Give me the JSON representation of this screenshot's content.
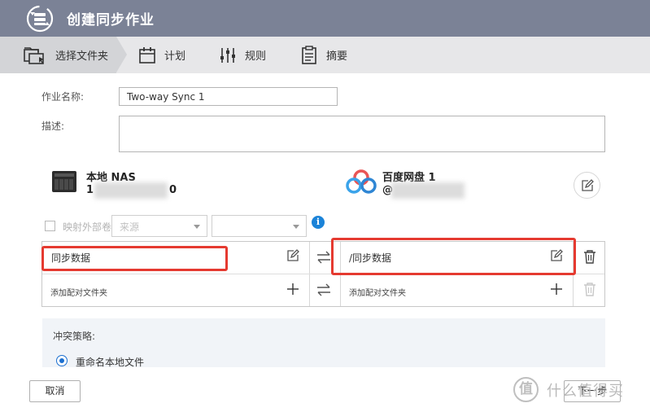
{
  "window": {
    "title": "创建同步作业"
  },
  "steps": [
    {
      "label": "选择文件夹",
      "icon": "folder-select-icon",
      "active": true
    },
    {
      "label": "计划",
      "icon": "calendar-icon",
      "active": false
    },
    {
      "label": "规则",
      "icon": "sliders-icon",
      "active": false
    },
    {
      "label": "摘要",
      "icon": "clipboard-icon",
      "active": false
    }
  ],
  "form": {
    "job_name_label": "作业名称:",
    "job_name_value": "Two-way Sync 1",
    "description_label": "描述:",
    "description_value": ""
  },
  "local": {
    "name": "本地 NAS",
    "address_start": "1",
    "address_end": "0"
  },
  "remote": {
    "name": "百度网盘 1",
    "account_start": "@"
  },
  "mapping": {
    "checkbox_label": "映射外部卷",
    "select1_value": "来源",
    "select2_value": ""
  },
  "table": {
    "rows": [
      {
        "local": "同步数据",
        "remote": "/同步数据"
      },
      {
        "local": "添加配对文件夹",
        "remote": "添加配对文件夹"
      }
    ]
  },
  "conflict": {
    "heading": "冲突策略:",
    "option_selected": "重命名本地文件"
  },
  "footer": {
    "cancel_label": "取消",
    "next_label": "下一步"
  },
  "watermark": {
    "logo": "值",
    "text": "什么值得买"
  },
  "colors": {
    "titlebar": "#7b8296",
    "highlight": "#e53a30",
    "accent": "#1b83d8"
  }
}
